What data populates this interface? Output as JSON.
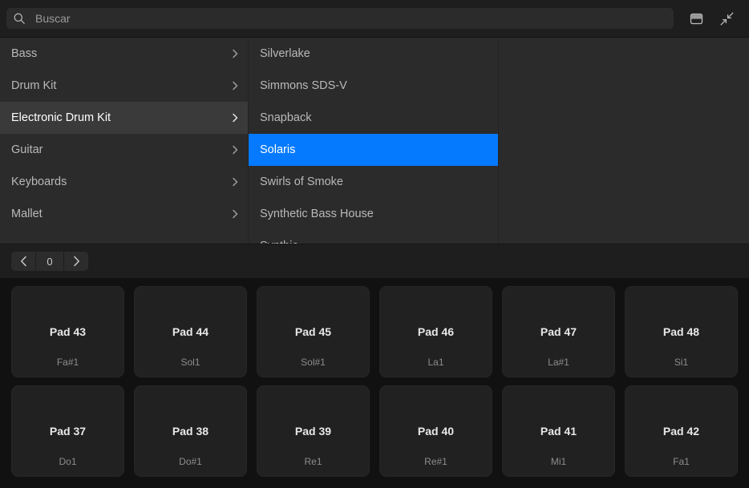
{
  "toolbar": {
    "search": {
      "icon": "search-icon",
      "value": "",
      "placeholder": "Buscar"
    },
    "buttons": [
      {
        "name": "layout-panel-icon",
        "title": "Panel"
      },
      {
        "name": "collapse-arrows-icon",
        "title": "Contraer"
      }
    ]
  },
  "browser": {
    "categories": [
      {
        "label": "Bass",
        "state": "normal"
      },
      {
        "label": "Drum Kit",
        "state": "normal"
      },
      {
        "label": "Electronic Drum Kit",
        "state": "selected"
      },
      {
        "label": "Guitar",
        "state": "normal"
      },
      {
        "label": "Keyboards",
        "state": "normal"
      },
      {
        "label": "Mallet",
        "state": "normal"
      }
    ],
    "patches": [
      {
        "label": "Silverlake",
        "state": "normal"
      },
      {
        "label": "Simmons SDS-V",
        "state": "normal"
      },
      {
        "label": "Snapback",
        "state": "normal"
      },
      {
        "label": "Solaris",
        "state": "active"
      },
      {
        "label": "Swirls of Smoke",
        "state": "normal"
      },
      {
        "label": "Synthetic Bass House",
        "state": "normal"
      },
      {
        "label": "Synthie",
        "state": "normal"
      }
    ],
    "detail": []
  },
  "pager": {
    "prev_icon": "chevron-left-icon",
    "next_icon": "chevron-right-icon",
    "value": "0"
  },
  "pads": [
    {
      "name": "Pad 43",
      "note": "Fa#1"
    },
    {
      "name": "Pad 44",
      "note": "Sol1"
    },
    {
      "name": "Pad 45",
      "note": "Sol#1"
    },
    {
      "name": "Pad 46",
      "note": "La1"
    },
    {
      "name": "Pad 47",
      "note": "La#1"
    },
    {
      "name": "Pad 48",
      "note": "Si1"
    },
    {
      "name": "Pad 37",
      "note": "Do1"
    },
    {
      "name": "Pad 38",
      "note": "Do#1"
    },
    {
      "name": "Pad 39",
      "note": "Re1"
    },
    {
      "name": "Pad 40",
      "note": "Re#1"
    },
    {
      "name": "Pad 41",
      "note": "Mi1"
    },
    {
      "name": "Pad 42",
      "note": "Fa1"
    }
  ],
  "colors": {
    "accent": "#057aff",
    "selected_row": "#3a3a3a",
    "panel_bg": "#2b2b2b",
    "grid_bg": "#111111",
    "pad_bg": "#212121",
    "toolbar_bg": "#1e1e1e"
  }
}
